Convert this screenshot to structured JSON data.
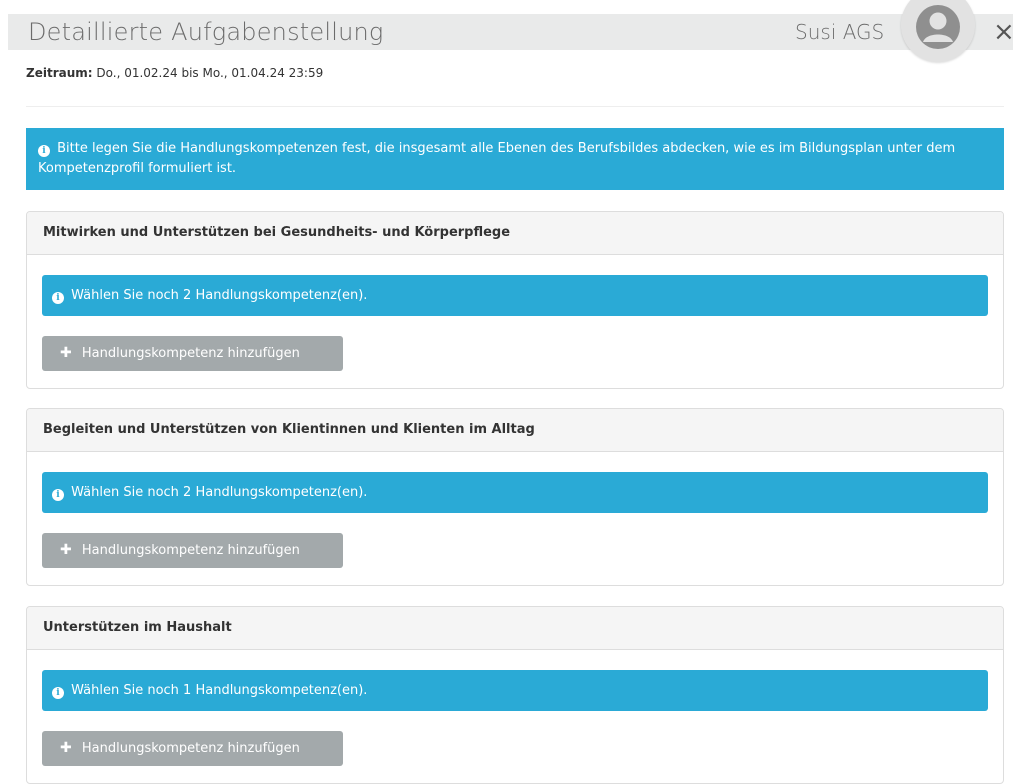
{
  "header": {
    "title": "Detaillierte Aufgabenstellung",
    "user_name": "Susi AGS",
    "close_glyph": "×",
    "background": "#e9eaea"
  },
  "period": {
    "label": "Zeitraum:",
    "value": "Do., 01.02.24 bis Mo., 01.04.24 23:59"
  },
  "info_alert": {
    "icon": "info-circle-icon",
    "text": "Bitte legen Sie die Handlungskompetenzen fest, die insgesamt alle Ebenen des Berufsbildes abdecken, wie es im Bildungsplan unter dem Kompetenzprofil formuliert ist."
  },
  "colors": {
    "alert_info": "#2aaad6",
    "button_disabled": "#a3a9ab",
    "panel_heading": "#f5f5f5"
  },
  "panels": [
    {
      "title": "Mitwirken und Unterstützen bei Gesundheits- und Körperpflege",
      "alert": "Wählen Sie noch 2 Handlungskompetenz(en).",
      "button": "Handlungskompetenz hinzufügen"
    },
    {
      "title": "Begleiten und Unterstützen von Klientinnen und Klienten im Alltag",
      "alert": "Wählen Sie noch 2 Handlungskompetenz(en).",
      "button": "Handlungskompetenz hinzufügen"
    },
    {
      "title": "Unterstützen im Haushalt",
      "alert": "Wählen Sie noch 1 Handlungskompetenz(en).",
      "button": "Handlungskompetenz hinzufügen"
    }
  ],
  "icons": {
    "info": "i",
    "plus": "✚"
  }
}
